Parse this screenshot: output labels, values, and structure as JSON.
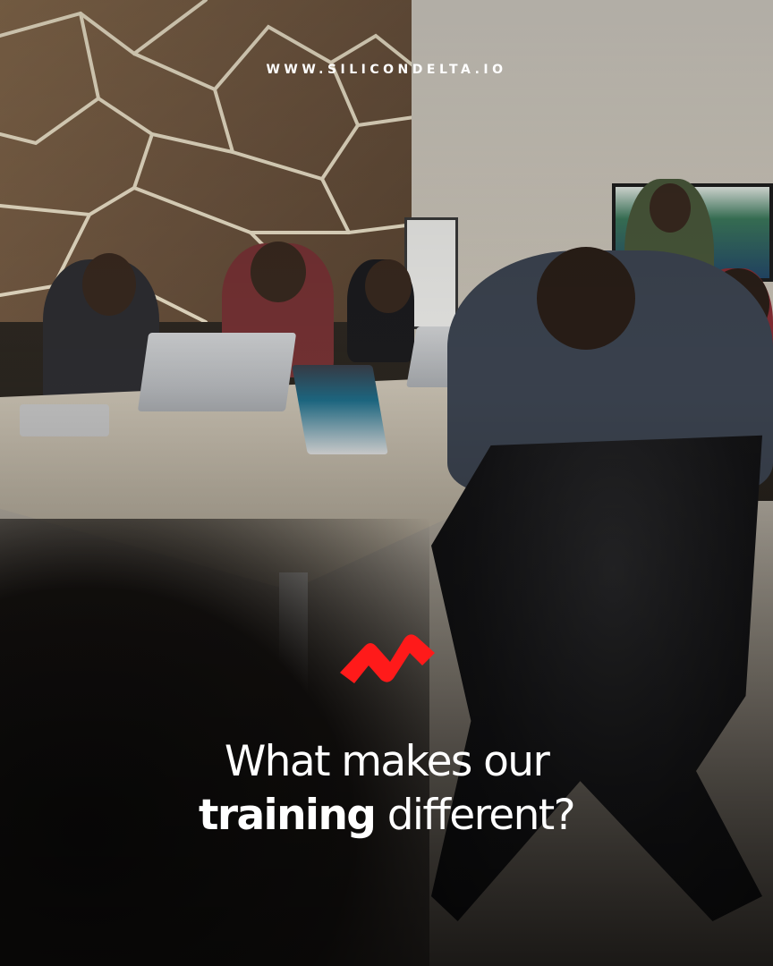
{
  "header": {
    "website": "WWW.SILICONDELTA.IO"
  },
  "brand": {
    "logo_icon": "silicondelta-logo-icon",
    "accent_color": "#ff1a1a"
  },
  "headline": {
    "line1": "What makes our",
    "line2_emphasis": "training",
    "line2_rest": " different?"
  },
  "colors": {
    "text": "#ffffff"
  }
}
